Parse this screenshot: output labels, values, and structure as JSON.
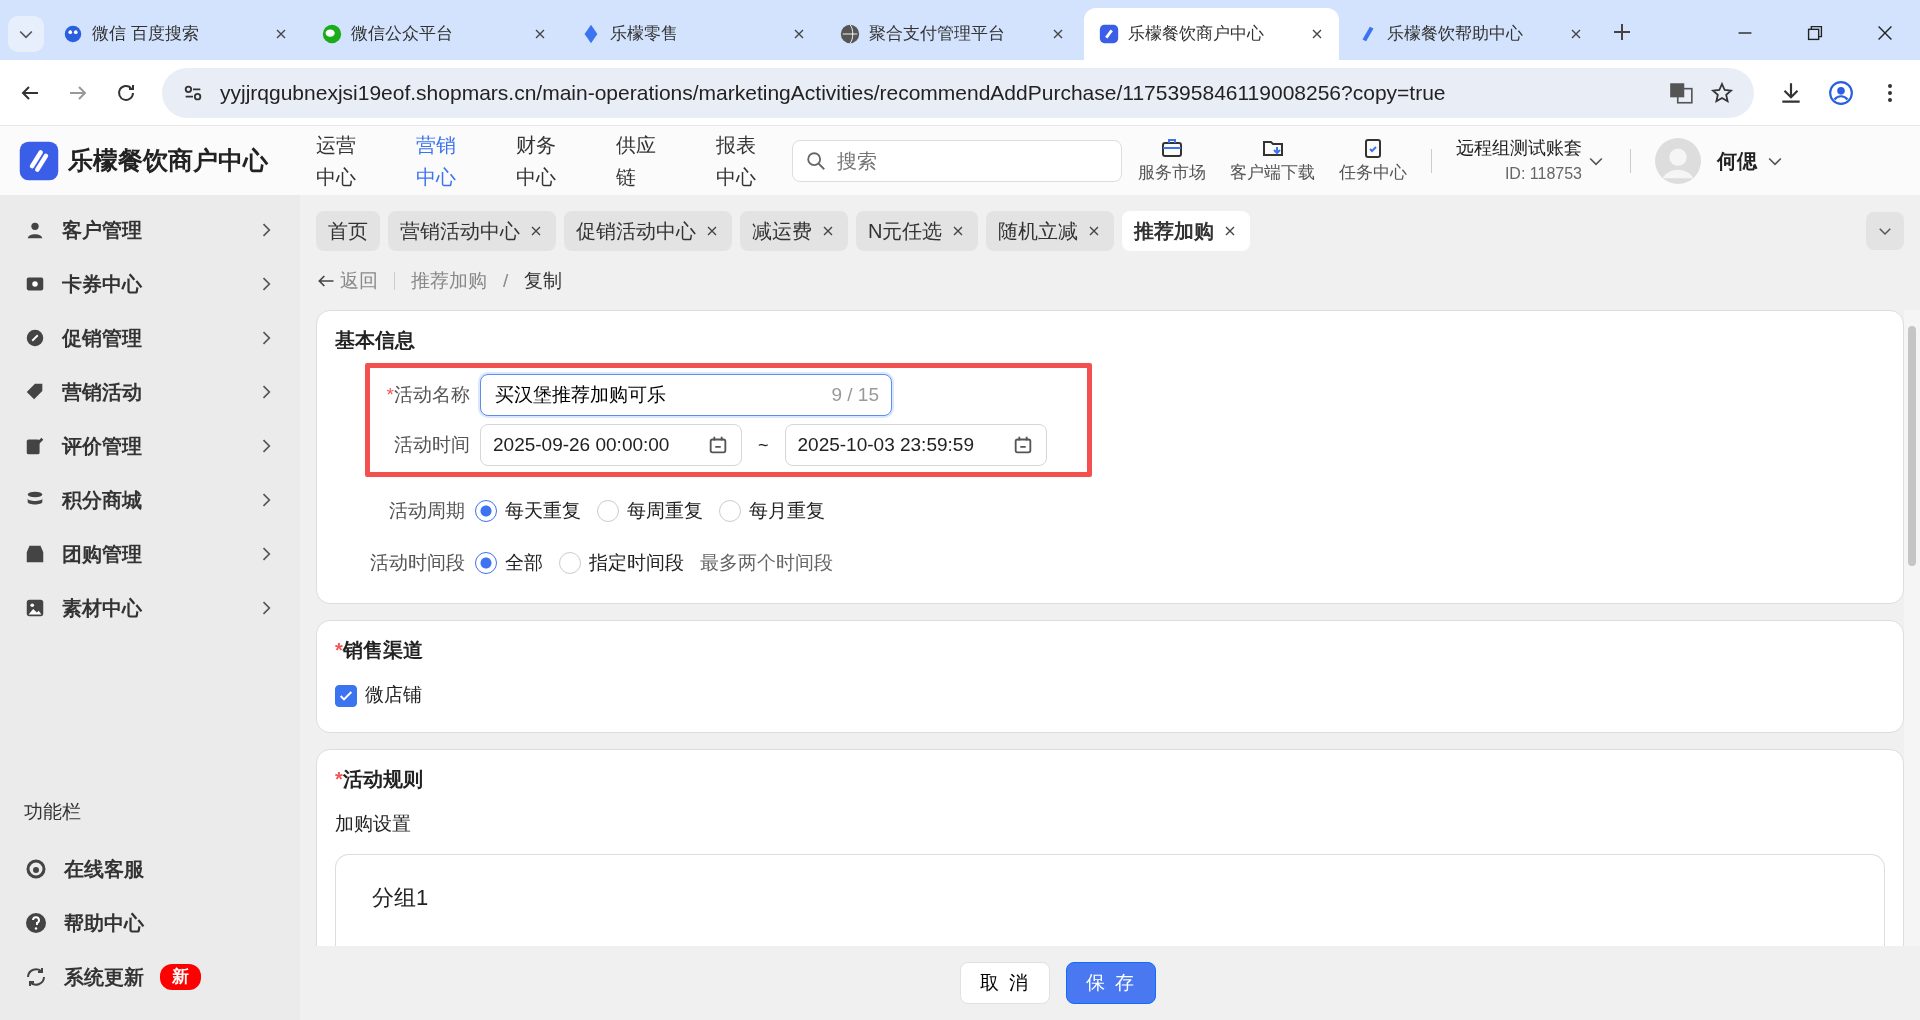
{
  "browser": {
    "tabs": [
      {
        "title": "微信 百度搜索",
        "selected": false
      },
      {
        "title": "微信公众平台",
        "selected": false
      },
      {
        "title": "乐檬零售",
        "selected": false
      },
      {
        "title": "聚合支付管理平台",
        "selected": false
      },
      {
        "title": "乐檬餐饮商户中心",
        "selected": true
      },
      {
        "title": "乐檬餐饮帮助中心",
        "selected": false
      }
    ],
    "url": "yyjjrqgubnexjsi19eof.shopmars.cn/main-operations/marketingActivities/recommendAddPurchase/1175395846119008256?copy=true"
  },
  "app": {
    "brand": "乐檬餐饮商户中心",
    "nav": [
      {
        "label": "运营中心",
        "selected": false
      },
      {
        "label": "营销中心",
        "selected": true
      },
      {
        "label": "财务中心",
        "selected": false
      },
      {
        "label": "供应链",
        "selected": false
      },
      {
        "label": "报表中心",
        "selected": false
      }
    ],
    "search": {
      "placeholder": "搜索"
    },
    "tools": [
      "服务市场",
      "客户端下载",
      "任务中心"
    ],
    "account": {
      "name": "远程组测试账套",
      "id": "ID: 118753"
    },
    "user": "何偲"
  },
  "sidebar": {
    "items": [
      "客户管理",
      "卡券中心",
      "促销管理",
      "营销活动",
      "评价管理",
      "积分商城",
      "团购管理",
      "素材中心"
    ],
    "section": "功能栏",
    "functions": [
      {
        "label": "在线客服"
      },
      {
        "label": "帮助中心"
      },
      {
        "label": "系统更新",
        "badge": "新"
      }
    ]
  },
  "page_tabs": [
    {
      "label": "首页",
      "closable": false,
      "selected": false
    },
    {
      "label": "营销活动中心",
      "closable": true,
      "selected": false
    },
    {
      "label": "促销活动中心",
      "closable": true,
      "selected": false
    },
    {
      "label": "减运费",
      "closable": true,
      "selected": false
    },
    {
      "label": "N元任选",
      "closable": true,
      "selected": false
    },
    {
      "label": "随机立减",
      "closable": true,
      "selected": false
    },
    {
      "label": "推荐加购",
      "closable": true,
      "selected": true
    }
  ],
  "breadcrumb": {
    "back": "返回",
    "items": [
      "推荐加购",
      "复制"
    ],
    "separator": "/"
  },
  "basic": {
    "title": "基本信息",
    "name": {
      "label": "活动名称",
      "required_mark": "*",
      "value": "买汉堡推荐加购可乐",
      "counter": "9 / 15"
    },
    "time": {
      "label": "活动时间",
      "start": "2025-09-26 00:00:00",
      "separator": "~",
      "end": "2025-10-03 23:59:59"
    },
    "cycle": {
      "label": "活动周期",
      "options": [
        {
          "label": "每天重复",
          "selected": true
        },
        {
          "label": "每周重复",
          "selected": false
        },
        {
          "label": "每月重复",
          "selected": false
        }
      ]
    },
    "period": {
      "label": "活动时间段",
      "options": [
        {
          "label": "全部",
          "selected": true
        },
        {
          "label": "指定时间段",
          "selected": false
        }
      ],
      "hint": "最多两个时间段"
    }
  },
  "channel": {
    "title": "销售渠道",
    "required_mark": "*",
    "options": [
      {
        "label": "微店铺",
        "checked": true
      }
    ]
  },
  "rules": {
    "title": "活动规则",
    "required_mark": "*",
    "subtitle": "加购设置",
    "group": "分组1"
  },
  "footer": {
    "cancel": "取 消",
    "save": "保 存"
  }
}
